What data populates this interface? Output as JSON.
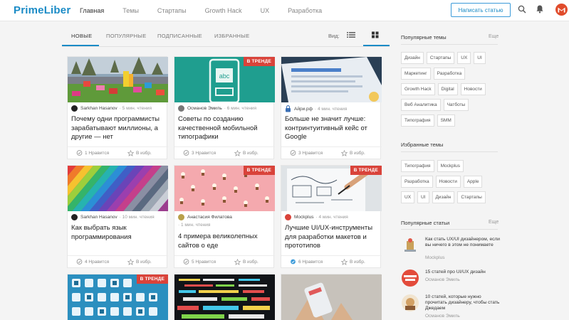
{
  "header": {
    "logo": "PrimeLiber",
    "nav": [
      "Главная",
      "Темы",
      "Стартапы",
      "Growth Hack",
      "UX",
      "Разработка"
    ],
    "write_button": "Написать статью",
    "avatar_letter": "M"
  },
  "feed": {
    "tabs": [
      "НОВЫЕ",
      "ПОПУЛЯРНЫЕ",
      "ПОДПИСАННЫЕ",
      "ИЗБРАННЫЕ"
    ],
    "view_label": "Вид:",
    "trend_label": "В ТРЕНДЕ",
    "in_fav_label": "В избр.",
    "cards": [
      {
        "author": "Sarkhan Hasanov",
        "read": "· 5 мин. чтения",
        "title": "Почему одни программисты зарабатывают миллионы, а другие — нет",
        "likes": "1 Нравится",
        "trend": false
      },
      {
        "author": "Османов Эмиль",
        "read": "· 6 мин. чтения",
        "title": "Советы по созданию качественной мобильной типографики",
        "likes": "3 Нравится",
        "trend": true
      },
      {
        "author": "Айри.рф",
        "read": "· 4 мин. чтения",
        "title": "Больше не значит лучше: контринтуитивный кейс от Google",
        "likes": "3 Нравится",
        "trend": false
      },
      {
        "author": "Sarkhan Hasanov",
        "read": "· 10 мин. чтения",
        "title": "Как выбрать язык программирования",
        "likes": "4 Нравится",
        "trend": false
      },
      {
        "author": "Анастасия Филатова",
        "read": "· 1 мин. чтения",
        "title": "4 примера великолепных сайтов о еде",
        "likes": "5 Нравится",
        "trend": true
      },
      {
        "author": "Mockplus",
        "read": "· 4 мин. чтения",
        "title": "Лучшие UI/UX-инструменты для разработки макетов и прототипов",
        "likes": "6 Нравится",
        "trend": true
      },
      {
        "trend": true
      },
      {
        "trend": false
      },
      {
        "trend": false
      }
    ]
  },
  "sidebar": {
    "popular_topics_title": "Популярные темы",
    "more": "Еще",
    "popular_topics": [
      "Дизайн",
      "Стартапы",
      "UX",
      "UI",
      "Маркетинг",
      "Разработка",
      "Growth Hack",
      "Digital",
      "Новости",
      "Веб Аналитика",
      "Чатботы",
      "Типография",
      "SMM"
    ],
    "selected_topics_title": "Избранные темы",
    "selected_topics": [
      "Типография",
      "Mockplus",
      "Разработка",
      "Новости",
      "Apple",
      "UX",
      "UI",
      "Дизайн",
      "Стартапы"
    ],
    "popular_articles_title": "Популярные статьи",
    "popular_articles": [
      {
        "title": "Как стать UX/UI дизайнером, если вы ничего в этом не понимаете",
        "author": "Mockplus"
      },
      {
        "title": "15 статей про UI/UX дизайн",
        "author": "Османов Эмиль"
      },
      {
        "title": "10 статей, которые нужно прочитать дизайнеру, чтобы стать Джедаем",
        "author": "Османов Эмиль"
      }
    ]
  },
  "colors": {
    "brand": "#1a8bc6",
    "trend": "#d9433a",
    "avatar": "#e04b2b"
  }
}
